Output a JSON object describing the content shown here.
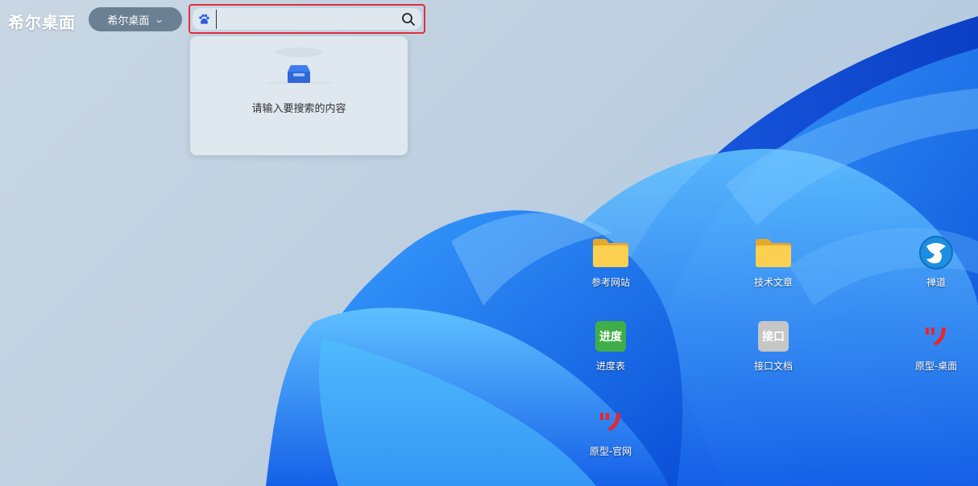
{
  "header": {
    "app_title": "希尔桌面",
    "workspace_label": "希尔桌面"
  },
  "search": {
    "engine_icon": "baidu-paw-icon",
    "value": "",
    "placeholder": "",
    "empty_message": "请输入要搜索的内容"
  },
  "desktop": {
    "icons": [
      {
        "label": "参考网站",
        "icon": "folder-icon"
      },
      {
        "label": "技术文章",
        "icon": "folder-icon"
      },
      {
        "label": "禅道",
        "icon": "zentao-icon"
      },
      {
        "label": "进度表",
        "icon": "tile-icon",
        "tile_text": "进度",
        "tile_color": "#3fae49"
      },
      {
        "label": "接口文档",
        "icon": "tile-icon",
        "tile_text": "接口",
        "tile_color": "#c6c6c6"
      },
      {
        "label": "原型-桌面",
        "icon": "axure-icon"
      },
      {
        "label": "原型-官网",
        "icon": "axure-icon"
      }
    ]
  },
  "colors": {
    "accent_red": "#e0303a",
    "folder": "#f9c53c",
    "zentao_blue": "#1d8fe0"
  }
}
